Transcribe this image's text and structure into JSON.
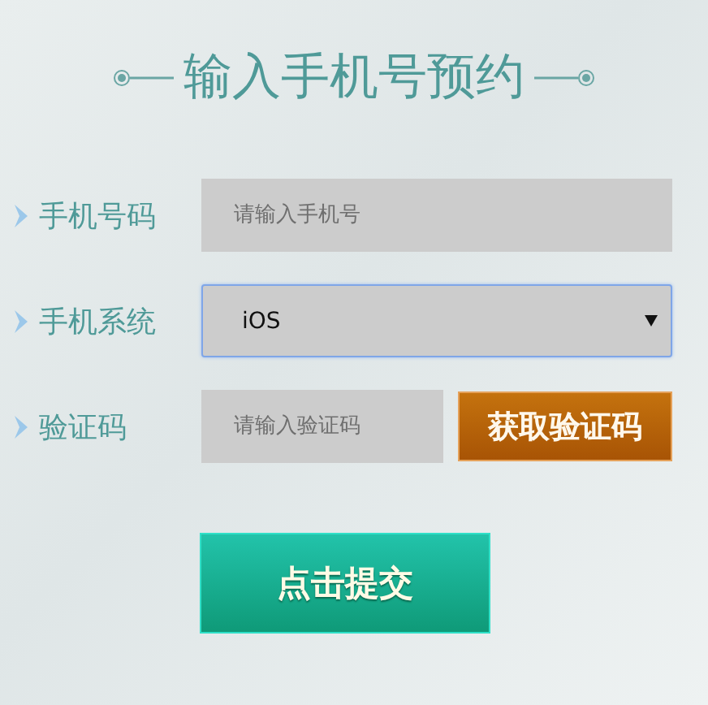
{
  "title": "输入手机号预约",
  "fields": [
    {
      "kind": "input",
      "label": "手机号码",
      "placeholder": "请输入手机号"
    },
    {
      "kind": "select",
      "label": "手机系统",
      "value": "iOS",
      "focused": true
    },
    {
      "kind": "code",
      "label": "验证码",
      "placeholder": "请输入验证码",
      "button": "获取验证码"
    }
  ],
  "submit": "点击提交"
}
